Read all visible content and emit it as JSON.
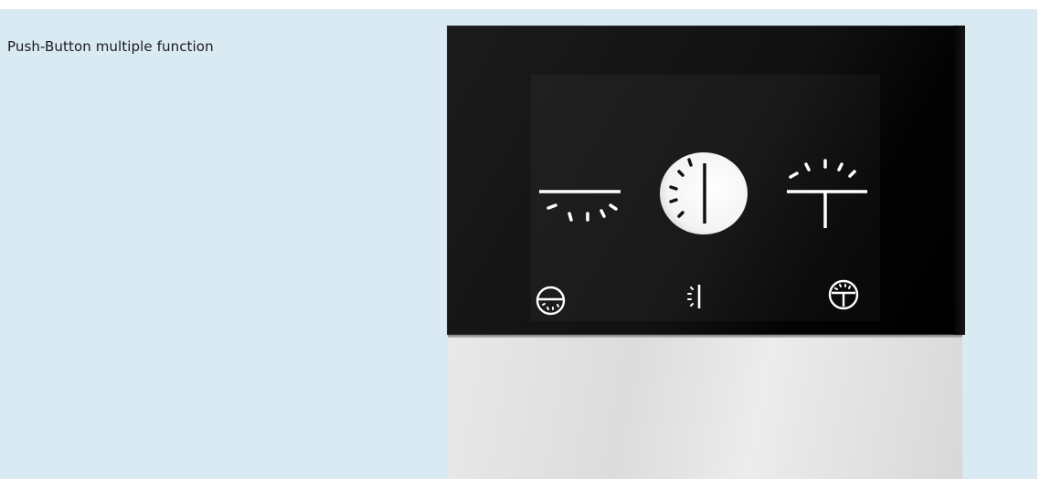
{
  "header": {
    "title": "Push-Button multiple function"
  },
  "device": {
    "name": "push-button",
    "buttons": [
      {
        "icon": "light-down-icon"
      },
      {
        "icon": "light-toggle-icon"
      },
      {
        "icon": "light-up-icon"
      }
    ],
    "indicators": [
      {
        "icon": "light-down-small-icon"
      },
      {
        "icon": "light-toggle-small-icon"
      },
      {
        "icon": "light-up-small-icon"
      }
    ]
  },
  "colors": {
    "background": "#daeaf3",
    "glass": "#111111",
    "symbols": "#ffffff",
    "base": "#e2e2e2"
  }
}
